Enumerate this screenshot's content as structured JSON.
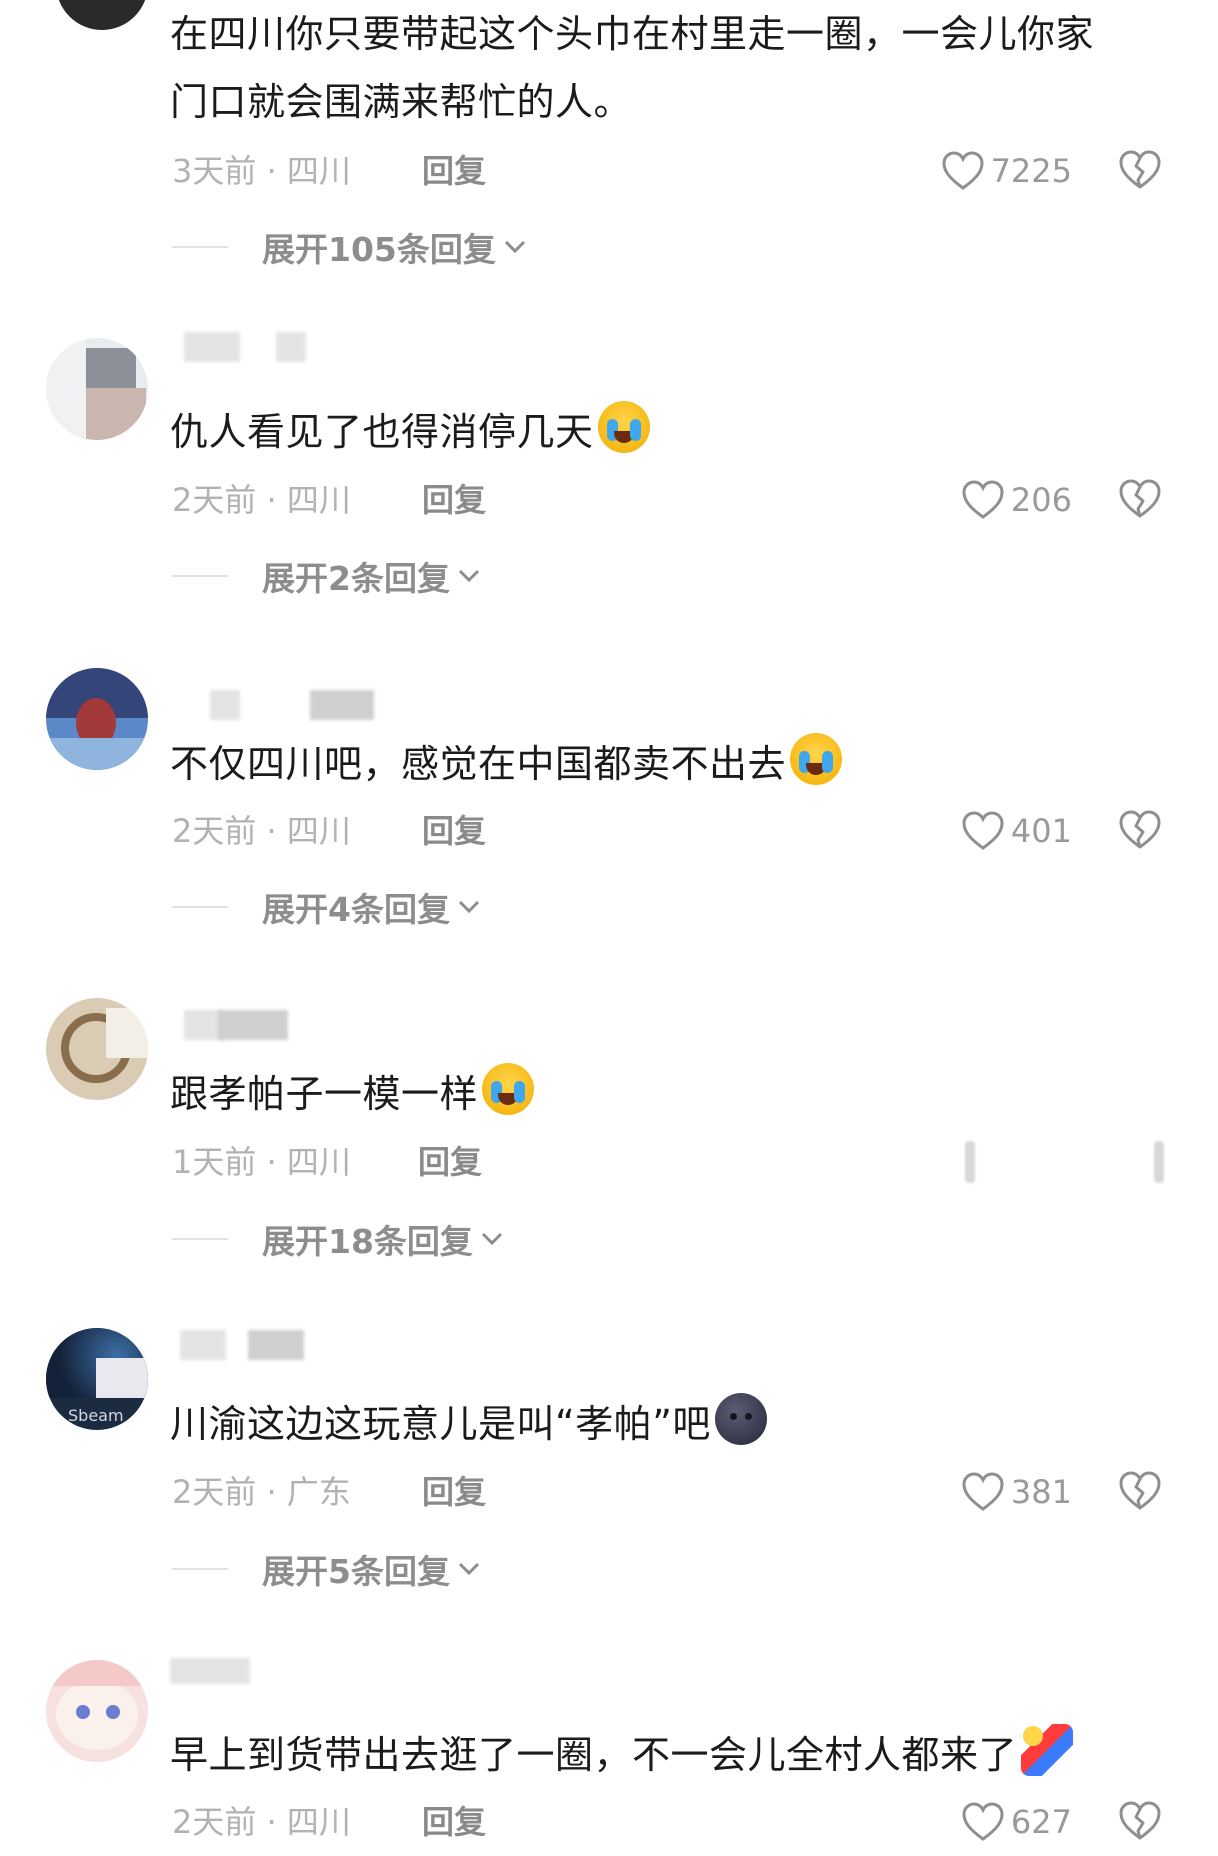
{
  "comments": [
    {
      "text": "在四川你只要带起这个头巾在村里走一圈，一会儿你家\n门口就会围满来帮忙的人。",
      "time": "3天前 · 四川",
      "reply": "回复",
      "likes": "7225",
      "expand": "展开105条回复"
    },
    {
      "text": "仇人看见了也得消停几天",
      "emoji": "crying-laughing-emoji",
      "time": "2天前 · 四川",
      "reply": "回复",
      "likes": "206",
      "expand": "展开2条回复"
    },
    {
      "text": "不仅四川吧，感觉在中国都卖不出去",
      "emoji": "crying-emoji",
      "time": "2天前 · 四川",
      "reply": "回复",
      "likes": "401",
      "expand": "展开4条回复"
    },
    {
      "text": "跟孝帕子一模一样",
      "emoji": "crying-emoji",
      "time": "1天前 · 四川",
      "reply": "回复",
      "expand": "展开18条回复"
    },
    {
      "text": "川渝这边这玩意儿是叫“孝帕”吧",
      "emoji": "dark-moon-emoji",
      "avatar_text": "Sbeam",
      "time": "2天前 · 广东",
      "reply": "回复",
      "likes": "381",
      "expand": "展开5条回复"
    },
    {
      "text": "早上到货带出去逛了一圈，不一会儿全村人都来了",
      "emoji": "falling-person-emoji",
      "time": "2天前 · 四川",
      "reply": "回复",
      "likes": "627"
    }
  ],
  "colors": {
    "text": "#1b1b1b",
    "meta": "#b2b2b2",
    "reply": "#8a8a8a",
    "icon": "#8f8f8f"
  }
}
